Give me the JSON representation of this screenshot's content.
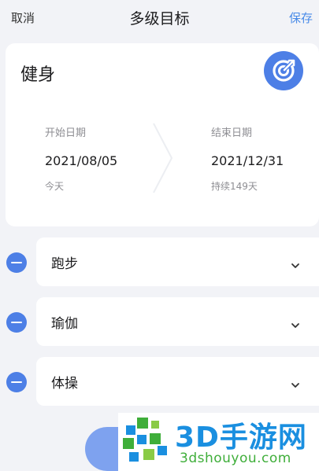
{
  "header": {
    "cancel_label": "取消",
    "title": "多级目标",
    "save_label": "保存"
  },
  "goal": {
    "name": "健身",
    "icon": "target-icon",
    "start": {
      "label": "开始日期",
      "date": "2021/08/05",
      "note": "今天"
    },
    "end": {
      "label": "结束日期",
      "date": "2021/12/31",
      "note": "持续149天"
    }
  },
  "subgoals": [
    {
      "label": "跑步"
    },
    {
      "label": "瑜伽"
    },
    {
      "label": "体操"
    }
  ],
  "watermark": {
    "brand": "3D手游网",
    "url": "3dshouyou.com"
  },
  "colors": {
    "accent": "#4d7fe6",
    "save": "#4a8be8",
    "background": "#f2f3f7"
  }
}
